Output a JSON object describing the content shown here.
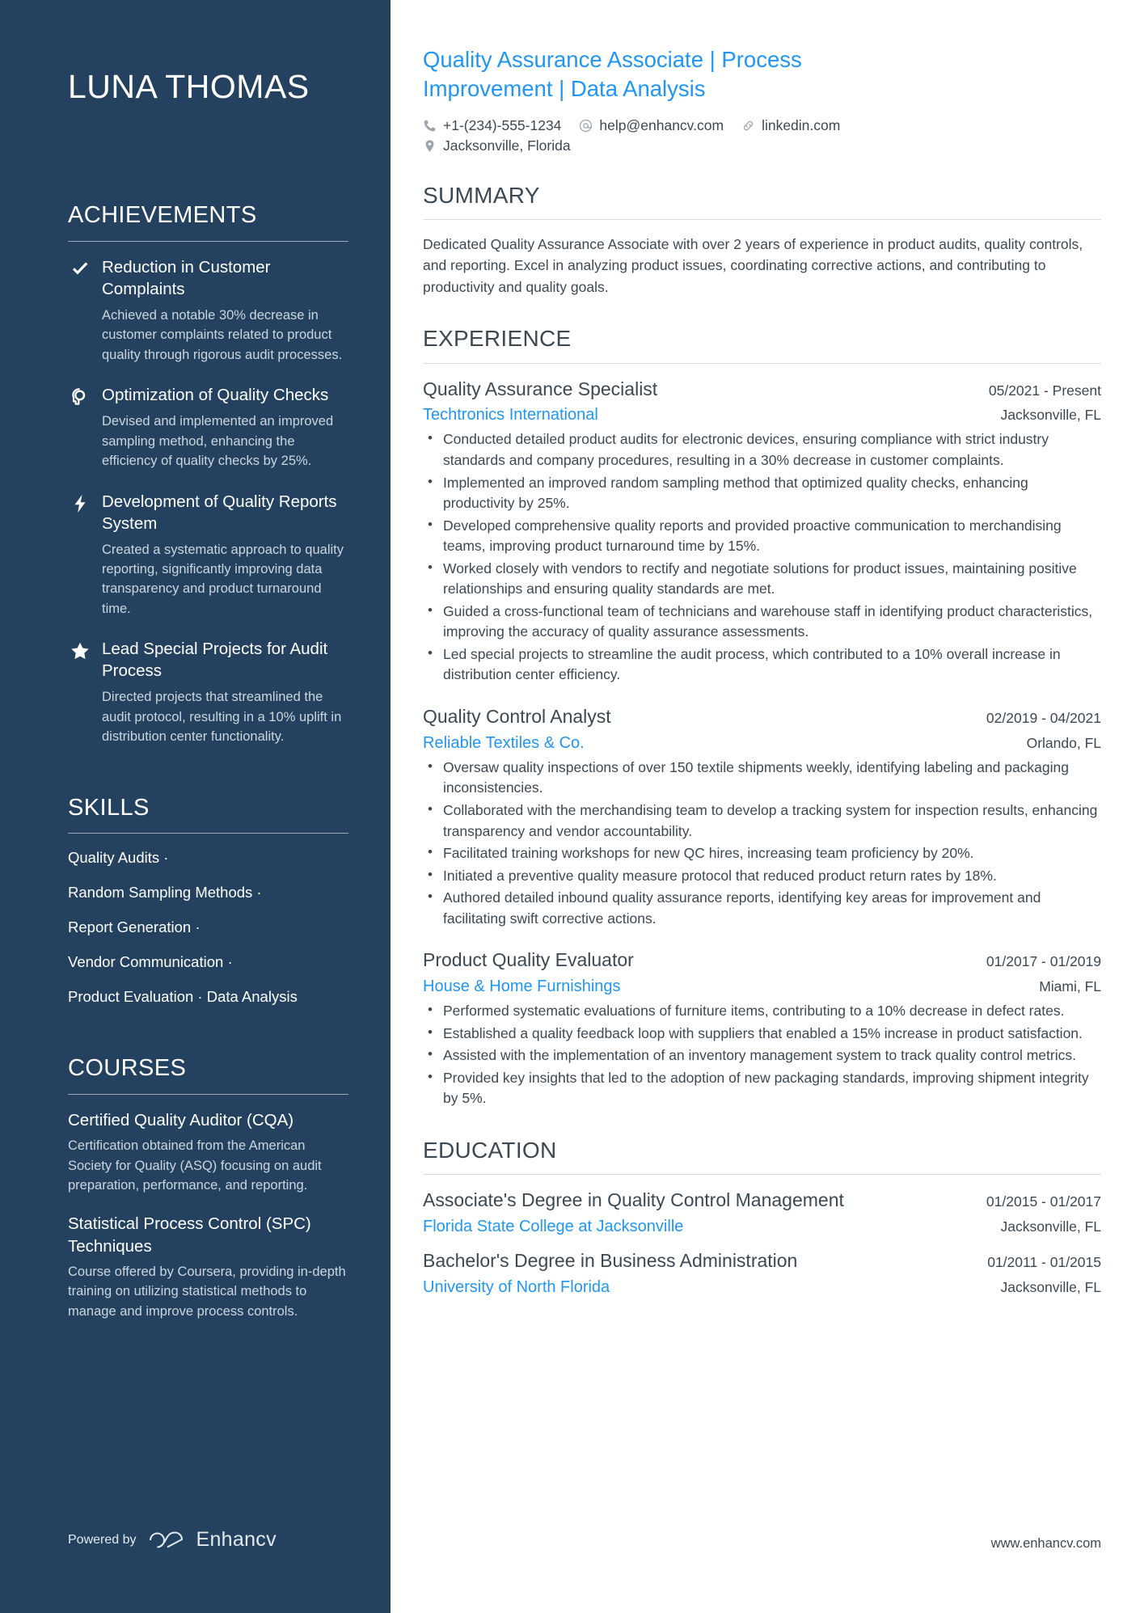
{
  "sidebar": {
    "name": "LUNA THOMAS",
    "achievements": {
      "heading": "ACHIEVEMENTS",
      "items": [
        {
          "icon": "check-icon",
          "title": "Reduction in Customer Complaints",
          "desc": "Achieved a notable 30% decrease in customer complaints related to product quality through rigorous audit processes."
        },
        {
          "icon": "head-idea-icon",
          "title": "Optimization of Quality Checks",
          "desc": "Devised and implemented an improved sampling method, enhancing the efficiency of quality checks by 25%."
        },
        {
          "icon": "lightning-bolt-icon",
          "title": "Development of Quality Reports System",
          "desc": "Created a systematic approach to quality reporting, significantly improving data transparency and product turnaround time."
        },
        {
          "icon": "star-icon",
          "title": "Lead Special Projects for Audit Process",
          "desc": "Directed projects that streamlined the audit protocol, resulting in a 10% uplift in distribution center functionality."
        }
      ]
    },
    "skills": {
      "heading": "SKILLS",
      "lines": [
        "Quality Audits ·",
        "Random Sampling Methods ·",
        "Report Generation ·",
        "Vendor Communication ·",
        "Product Evaluation · Data Analysis"
      ]
    },
    "courses": {
      "heading": "COURSES",
      "items": [
        {
          "title": "Certified Quality Auditor (CQA)",
          "desc": "Certification obtained from the American Society for Quality (ASQ) focusing on audit preparation, performance, and reporting."
        },
        {
          "title": "Statistical Process Control (SPC) Techniques",
          "desc": "Course offered by Coursera, providing in-depth training on utilizing statistical methods to manage and improve process controls."
        }
      ]
    },
    "powered": {
      "label": "Powered by",
      "brand": "Enhancv"
    }
  },
  "main": {
    "headline": "Quality Assurance Associate | Process Improvement | Data Analysis",
    "contacts": {
      "phone": "+1-(234)-555-1234",
      "email": "help@enhancv.com",
      "linkedin": "linkedin.com",
      "location": "Jacksonville, Florida"
    },
    "summary": {
      "heading": "SUMMARY",
      "text": "Dedicated Quality Assurance Associate with over 2 years of experience in product audits, quality controls, and reporting. Excel in analyzing product issues, coordinating corrective actions, and contributing to productivity and quality goals."
    },
    "experience": {
      "heading": "EXPERIENCE",
      "entries": [
        {
          "title": "Quality Assurance Specialist",
          "date": "05/2021 - Present",
          "org": "Techtronics International",
          "location": "Jacksonville, FL",
          "bullets": [
            "Conducted detailed product audits for electronic devices, ensuring compliance with strict industry standards and company procedures, resulting in a 30% decrease in customer complaints.",
            "Implemented an improved random sampling method that optimized quality checks, enhancing productivity by 25%.",
            "Developed comprehensive quality reports and provided proactive communication to merchandising teams, improving product turnaround time by 15%.",
            "Worked closely with vendors to rectify and negotiate solutions for product issues, maintaining positive relationships and ensuring quality standards are met.",
            "Guided a cross-functional team of technicians and warehouse staff in identifying product characteristics, improving the accuracy of quality assurance assessments.",
            "Led special projects to streamline the audit process, which contributed to a 10% overall increase in distribution center efficiency."
          ]
        },
        {
          "title": "Quality Control Analyst",
          "date": "02/2019 - 04/2021",
          "org": "Reliable Textiles & Co.",
          "location": "Orlando, FL",
          "bullets": [
            "Oversaw quality inspections of over 150 textile shipments weekly, identifying labeling and packaging inconsistencies.",
            "Collaborated with the merchandising team to develop a tracking system for inspection results, enhancing transparency and vendor accountability.",
            "Facilitated training workshops for new QC hires, increasing team proficiency by 20%.",
            "Initiated a preventive quality measure protocol that reduced product return rates by 18%.",
            "Authored detailed inbound quality assurance reports, identifying key areas for improvement and facilitating swift corrective actions."
          ]
        },
        {
          "title": "Product Quality Evaluator",
          "date": "01/2017 - 01/2019",
          "org": "House & Home Furnishings",
          "location": "Miami, FL",
          "bullets": [
            "Performed systematic evaluations of furniture items, contributing to a 10% decrease in defect rates.",
            "Established a quality feedback loop with suppliers that enabled a 15% increase in product satisfaction.",
            "Assisted with the implementation of an inventory management system to track quality control metrics.",
            "Provided key insights that led to the adoption of new packaging standards, improving shipment integrity by 5%."
          ]
        }
      ]
    },
    "education": {
      "heading": "EDUCATION",
      "entries": [
        {
          "title": "Associate's Degree in Quality Control Management",
          "date": "01/2015 - 01/2017",
          "org": "Florida State College at Jacksonville",
          "location": "Jacksonville, FL"
        },
        {
          "title": "Bachelor's Degree in Business Administration",
          "date": "01/2011 - 01/2015",
          "org": "University of North Florida",
          "location": "Jacksonville, FL"
        }
      ]
    },
    "footer_url": "www.enhancv.com"
  },
  "colors": {
    "sidebar_bg": "#24425f",
    "accent_blue": "#2196f3",
    "body_text": "#3c4852"
  }
}
